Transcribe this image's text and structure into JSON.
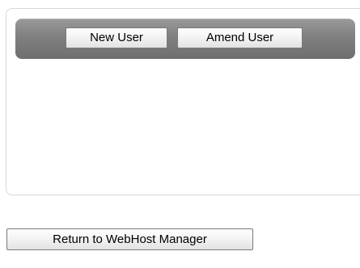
{
  "toolbar": {
    "new_user_label": "New User",
    "amend_user_label": "Amend User"
  },
  "footer": {
    "return_label": "Return to WebHost Manager"
  }
}
